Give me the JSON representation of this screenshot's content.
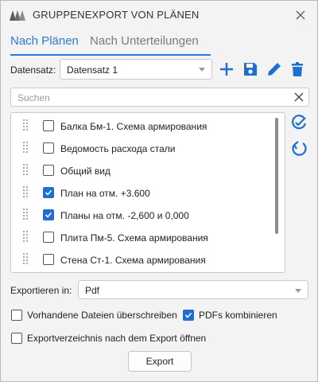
{
  "window": {
    "title": "GRUPPENEXPORT VON PLÄNEN"
  },
  "tabs": [
    {
      "label": "Nach Plänen",
      "active": true
    },
    {
      "label": "Nach Unterteilungen",
      "active": false
    }
  ],
  "dataset": {
    "label": "Datensatz:",
    "value": "Datensatz 1"
  },
  "toolbar_icons": [
    "plus-icon",
    "save-icon",
    "edit-icon",
    "trash-icon"
  ],
  "search": {
    "placeholder": "Suchen",
    "value": ""
  },
  "plans": [
    {
      "label": "Балка Бм-1. Схема армирования",
      "checked": false
    },
    {
      "label": "Ведомость расхода стали",
      "checked": false
    },
    {
      "label": "Общий вид",
      "checked": false
    },
    {
      "label": "План на отм. +3.600",
      "checked": true
    },
    {
      "label": "Планы на отм. -2,600 и 0,000",
      "checked": true
    },
    {
      "label": "Плита Пм-5. Схема армирования",
      "checked": false
    },
    {
      "label": "Стена Ст-1. Схема армирования",
      "checked": false
    }
  ],
  "side_icons": [
    "select-all-icon",
    "deselect-all-icon"
  ],
  "export_format": {
    "label": "Exportieren in:",
    "value": "Pdf"
  },
  "options": {
    "overwrite": {
      "label": "Vorhandene Dateien überschreiben",
      "checked": false
    },
    "combine": {
      "label": "PDFs kombinieren",
      "checked": true
    },
    "open_dir": {
      "label": "Exportverzeichnis nach dem Export öffnen",
      "checked": false
    }
  },
  "export_button": "Export",
  "colors": {
    "accent": "#2b79d4",
    "checkbox": "#1f6fd0",
    "background": "#f3f3f3"
  }
}
